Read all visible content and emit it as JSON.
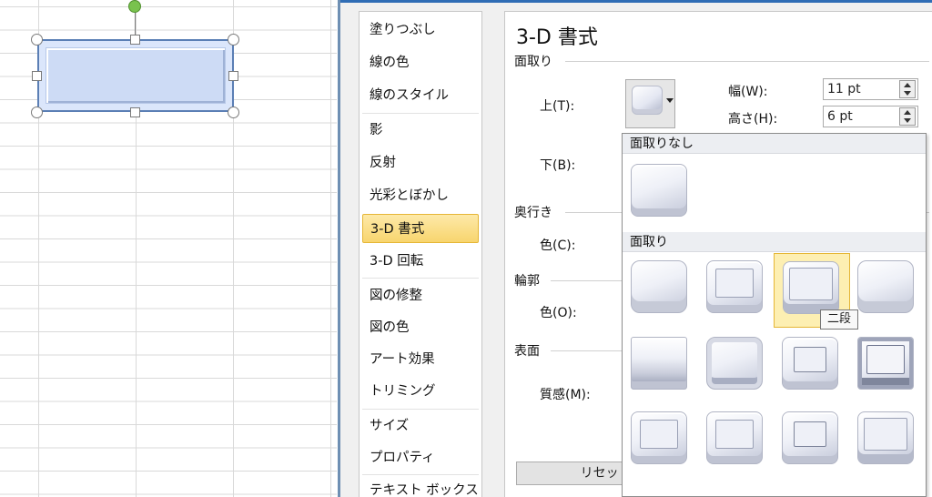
{
  "dialog": {
    "nav_items": [
      {
        "label": "塗りつぶし"
      },
      {
        "label": "線の色"
      },
      {
        "label": "線のスタイル"
      },
      {
        "label": "影"
      },
      {
        "label": "反射"
      },
      {
        "label": "光彩とぼかし"
      },
      {
        "label": "3-D 書式",
        "selected": true
      },
      {
        "label": "3-D 回転"
      },
      {
        "label": "図の修整"
      },
      {
        "label": "図の色"
      },
      {
        "label": "アート効果"
      },
      {
        "label": "トリミング"
      },
      {
        "label": "サイズ"
      },
      {
        "label": "プロパティ"
      },
      {
        "label": "テキスト ボックス"
      }
    ],
    "panel": {
      "title": "3-D 書式",
      "bevel_section": "面取り",
      "top_label": "上(T):",
      "bottom_label": "下(B):",
      "width_label": "幅(W):",
      "width_value": "11 pt",
      "height_label": "高さ(H):",
      "height_value": "6 pt",
      "depth_section": "奥行き",
      "depth_color_label": "色(C):",
      "contour_section": "輪郭",
      "contour_color_label": "色(O):",
      "surface_section": "表面",
      "material_label": "質感(M):",
      "reset_label": "リセット(R)"
    },
    "gallery": {
      "no_bevel_header": "面取りなし",
      "bevel_header": "面取り",
      "highlighted_index": 2,
      "tooltip": "二段"
    }
  },
  "colors": {
    "selected_nav": "#f8d56e",
    "shape_fill": "#dbe6fb",
    "rotation_handle": "#79c24e"
  }
}
